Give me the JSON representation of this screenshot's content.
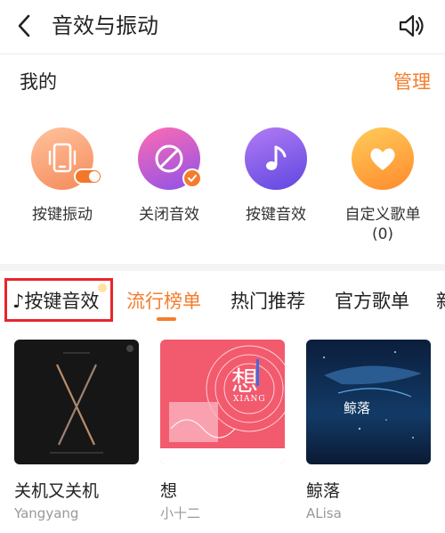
{
  "header": {
    "title": "音效与振动",
    "back_icon": "chevron-left-icon",
    "speaker_icon": "speaker-icon"
  },
  "mine": {
    "title": "我的",
    "manage_label": "管理",
    "features": [
      {
        "label": "按键振动",
        "icon": "phone-vibrate-icon"
      },
      {
        "label": "关闭音效",
        "icon": "no-sound-icon"
      },
      {
        "label": "按键音效",
        "icon": "music-note-icon"
      },
      {
        "label": "自定义歌单",
        "count": "(0)",
        "icon": "heart-icon"
      }
    ]
  },
  "tabs": [
    {
      "label": "♪按键音效"
    },
    {
      "label": "流行榜单",
      "active": true
    },
    {
      "label": "热门推荐"
    },
    {
      "label": "官方歌单"
    },
    {
      "label": "新"
    }
  ],
  "cards": [
    {
      "title": "关机又关机",
      "subtitle": "Yangyang"
    },
    {
      "title": "想",
      "subtitle": "小十二",
      "cover_char": "想",
      "cover_latin": "XIANG"
    },
    {
      "title": "鲸落",
      "subtitle": "ALisa",
      "cover_char": "鲸落"
    }
  ],
  "colors": {
    "accent": "#f37d2c",
    "highlight_box": "#e6262b"
  }
}
